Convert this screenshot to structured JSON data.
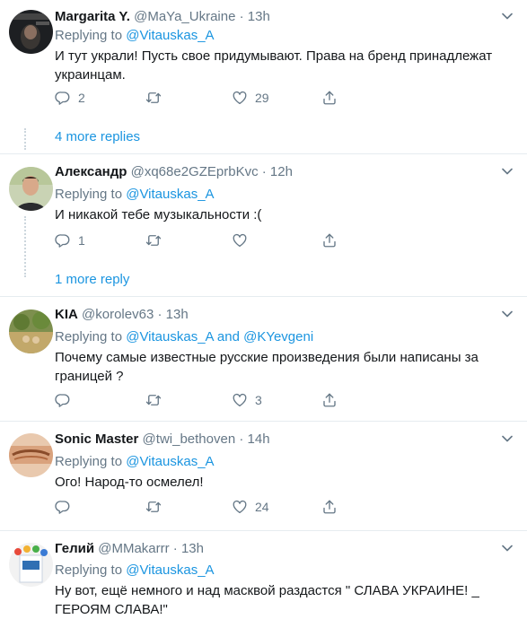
{
  "tweets": [
    {
      "name": "Margarita Y.",
      "handle": "@MaYa_Ukraine",
      "dot": "·",
      "time": "13h",
      "replying_prefix": "Replying to",
      "replying_to": "@Vitauskas_A",
      "text": "И тут украли! Пусть свое придумывают. Права на бренд принадлежат украинцам.",
      "reply_count": "2",
      "retweet_count": "",
      "like_count": "29",
      "more_replies": "4 more replies"
    },
    {
      "name": "Александр",
      "handle": "@xq68e2GZEprbKvc",
      "dot": "·",
      "time": "12h",
      "replying_prefix": "Replying to",
      "replying_to": "@Vitauskas_A",
      "text": "И никакой тебе музыкальности :(",
      "reply_count": "1",
      "retweet_count": "",
      "like_count": "",
      "more_replies": "1 more reply"
    },
    {
      "name": "KIA",
      "handle": "@korolev63",
      "dot": "·",
      "time": "13h",
      "replying_prefix": "Replying to",
      "replying_to": "@Vitauskas_A and @KYevgeni",
      "text": "Почему самые известные русские произведения были написаны за границей ?",
      "reply_count": "",
      "retweet_count": "",
      "like_count": "3"
    },
    {
      "name": "Sonic Master",
      "handle": "@twi_bethoven",
      "dot": "·",
      "time": "14h",
      "replying_prefix": "Replying to",
      "replying_to": "@Vitauskas_A",
      "text": "Ого! Народ-то осмелел!",
      "reply_count": "",
      "retweet_count": "",
      "like_count": "24"
    },
    {
      "name": "Гелий",
      "handle": "@MMakarrr",
      "dot": "·",
      "time": "13h",
      "replying_prefix": "Replying to",
      "replying_to": "@Vitauskas_A",
      "text": "Ну вот, ещё немного и над масквой раздастся \" СЛАВА УКРАИНЕ! _ ГЕРОЯМ СЛАВА!\""
    }
  ],
  "colors": {
    "link": "#1b95e0",
    "muted": "#657786",
    "text": "#14171a",
    "divider": "#e6ecf0"
  },
  "icons": [
    "reply-icon",
    "retweet-icon",
    "like-icon",
    "share-icon",
    "chevron-down-icon"
  ]
}
